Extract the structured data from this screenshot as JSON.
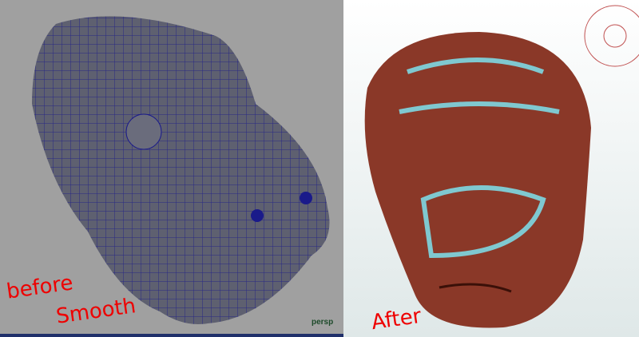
{
  "left_viewport": {
    "camera_label": "persp",
    "annotation": [
      "before",
      "Smooth"
    ]
  },
  "right_viewport": {
    "annotation": "After"
  },
  "colors": {
    "viewport_bg": "#a0a0a0",
    "mesh": "#5e6070",
    "wire": "#1a1a8a",
    "clay": "#8a3828",
    "seam": "#7fc8d0"
  }
}
